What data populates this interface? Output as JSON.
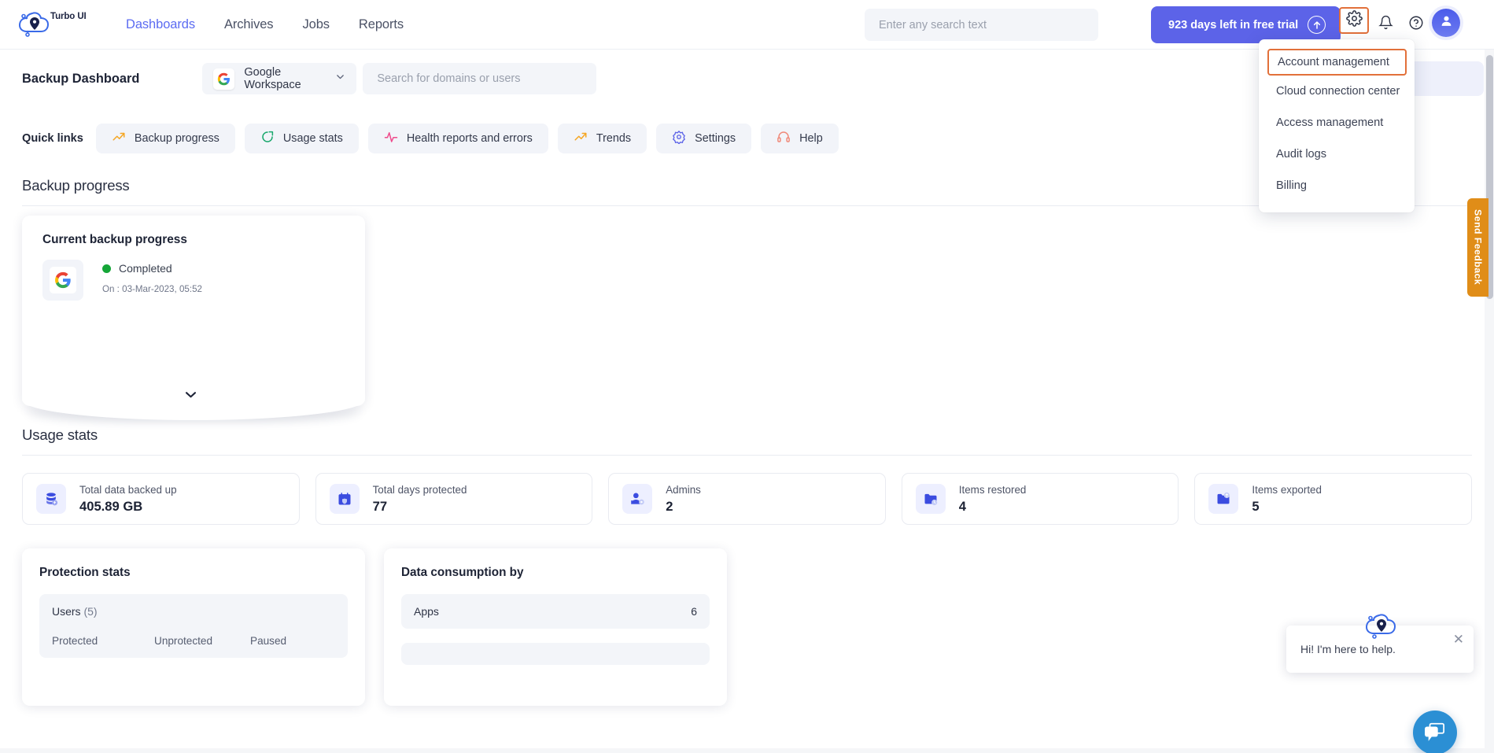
{
  "app": {
    "brand_name": "Turbo UI",
    "logo_icon": "cloud-pin-logo"
  },
  "topnav": {
    "links": [
      {
        "label": "Dashboards",
        "active": true
      },
      {
        "label": "Archives",
        "active": false
      },
      {
        "label": "Jobs",
        "active": false
      },
      {
        "label": "Reports",
        "active": false
      }
    ],
    "search_placeholder": "Enter any search text",
    "search_value": "",
    "trial": {
      "label": "923 days left in free trial",
      "arrow_icon": "arrow-up-circle-icon"
    },
    "icons": {
      "gear": "gear-icon",
      "bell": "bell-icon",
      "help": "question-circle-icon",
      "avatar": "user-avatar-icon"
    }
  },
  "settings_menu": {
    "items": [
      {
        "label": "Account management",
        "highlighted": true
      },
      {
        "label": "Cloud connection center",
        "highlighted": false
      },
      {
        "label": "Access management",
        "highlighted": false
      },
      {
        "label": "Audit logs",
        "highlighted": false
      },
      {
        "label": "Billing",
        "highlighted": false
      }
    ]
  },
  "dashboard_header": {
    "title": "Backup Dashboard",
    "workspace": {
      "label": "Google Workspace",
      "icon": "google-g-icon",
      "chevron": "chevron-down-icon"
    },
    "domain_search_placeholder": "Search for domains or users",
    "domain_search_value": ""
  },
  "quick_links": {
    "label": "Quick links",
    "items": [
      {
        "label": "Backup progress",
        "icon": "trend-up-icon",
        "color": "#f5a623"
      },
      {
        "label": "Usage stats",
        "icon": "pie-chart-icon",
        "color": "#1aa86d"
      },
      {
        "label": "Health reports and errors",
        "icon": "pulse-icon",
        "color": "#ef4b8c"
      },
      {
        "label": "Trends",
        "icon": "trend-up-icon",
        "color": "#f5a623"
      },
      {
        "label": "Settings",
        "icon": "gear-icon",
        "color": "#5c63e8"
      },
      {
        "label": "Help",
        "icon": "headset-icon",
        "color": "#f08a7a"
      }
    ]
  },
  "backup_progress": {
    "section_title": "Backup progress",
    "card_title": "Current backup progress",
    "app_icon": "google-g-icon",
    "status": "Completed",
    "status_color": "#15a638",
    "timestamp": "On : 03-Mar-2023, 05:52",
    "expand_icon": "chevron-down-icon"
  },
  "usage_stats": {
    "section_title": "Usage stats",
    "cards": [
      {
        "label": "Total data backed up",
        "value": "405.89 GB",
        "icon": "database-icon"
      },
      {
        "label": "Total days protected",
        "value": "77",
        "icon": "calendar-shield-icon"
      },
      {
        "label": "Admins",
        "value": "2",
        "icon": "user-gear-icon"
      },
      {
        "label": "Items restored",
        "value": "4",
        "icon": "folder-restore-icon"
      },
      {
        "label": "Items exported",
        "value": "5",
        "icon": "folder-export-icon"
      }
    ]
  },
  "protection_stats": {
    "title": "Protection stats",
    "group_label": "Users",
    "group_count": "(5)",
    "columns": [
      "Protected",
      "Unprotected",
      "Paused"
    ]
  },
  "data_consumption": {
    "title": "Data consumption by",
    "rows": [
      {
        "label": "Apps",
        "value": "6"
      }
    ]
  },
  "feedback": {
    "label": "Send Feedback",
    "color": "#e08d18"
  },
  "chat": {
    "message": "Hi! I'm here to help.",
    "close_icon": "close-icon",
    "logo_icon": "cloud-pin-logo",
    "fab_icon": "chat-bubble-icon",
    "fab_color": "#2b8fd4"
  }
}
